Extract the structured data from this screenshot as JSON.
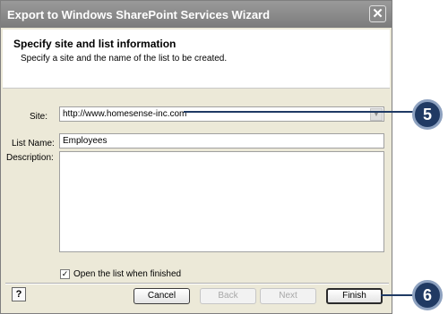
{
  "window": {
    "title": "Export to Windows SharePoint Services Wizard",
    "close_glyph": "✕"
  },
  "header": {
    "title": "Specify site and list information",
    "subtitle": "Specify a site and the name of the list to be created."
  },
  "form": {
    "site_label": "Site:",
    "site_value": "http://www.homesense-inc.com",
    "list_name_label": "List Name:",
    "list_name_value": "Employees",
    "description_label": "Description:",
    "description_value": "",
    "open_list_label": "Open the list when finished",
    "open_list_checked": true
  },
  "buttons": {
    "help": "?",
    "cancel": "Cancel",
    "back": "Back",
    "next": "Next",
    "finish": "Finish"
  },
  "callouts": {
    "site": "5",
    "finish": "6"
  },
  "colors": {
    "callout": "#203a63",
    "titlebar": "#8a8a8a"
  }
}
